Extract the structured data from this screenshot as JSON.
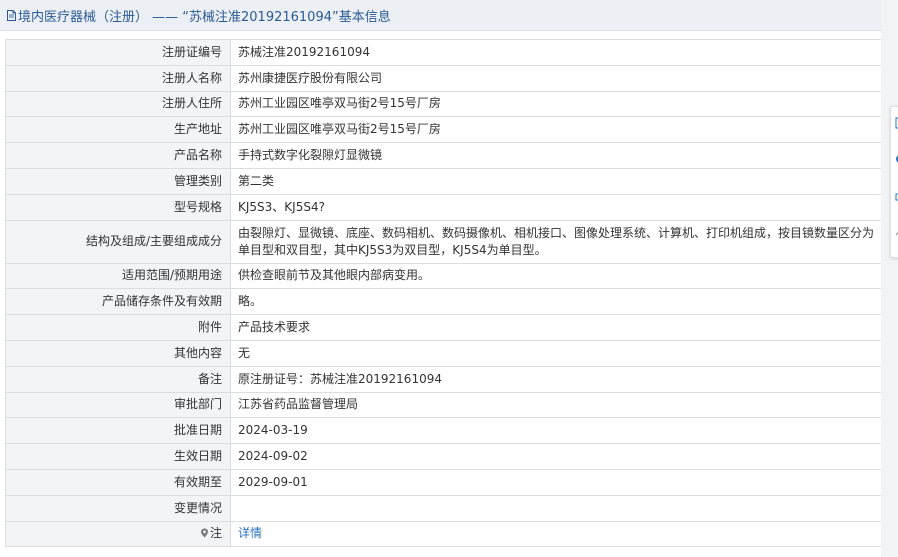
{
  "header": {
    "title": "境内医疗器械（注册） —— “苏械注准20192161094”基本信息"
  },
  "colors": {
    "header_bg": "#eceff3",
    "header_text": "#2a5b94",
    "label_bg": "#f3f4f6",
    "border": "#dddddd",
    "link": "#2a73c2"
  },
  "rows": [
    {
      "label": "注册证编号",
      "value": "苏械注准20192161094"
    },
    {
      "label": "注册人名称",
      "value": "苏州康捷医疗股份有限公司"
    },
    {
      "label": "注册人住所",
      "value": "苏州工业园区唯亭双马街2号15号厂房"
    },
    {
      "label": "生产地址",
      "value": "苏州工业园区唯亭双马街2号15号厂房"
    },
    {
      "label": "产品名称",
      "value": "手持式数字化裂隙灯显微镜"
    },
    {
      "label": "管理类别",
      "value": "第二类"
    },
    {
      "label": "型号规格",
      "value": "KJ5S3、KJ5S4?"
    },
    {
      "label": "结构及组成/主要组成成分",
      "value": "由裂隙灯、显微镜、底座、数码相机、数码摄像机、相机接口、图像处理系统、计算机、打印机组成，按目镜数量区分为单目型和双目型，其中KJ5S3为双目型，KJ5S4为单目型。"
    },
    {
      "label": "适用范围/预期用途",
      "value": "供检查眼前节及其他眼内部病变用。"
    },
    {
      "label": "产品储存条件及有效期",
      "value": "略。"
    },
    {
      "label": "附件",
      "value": "产品技术要求"
    },
    {
      "label": "其他内容",
      "value": "无"
    },
    {
      "label": "备注",
      "value": "原注册证号：苏械注准20192161094"
    },
    {
      "label": "审批部门",
      "value": "江苏省药品监督管理局"
    },
    {
      "label": "批准日期",
      "value": "2024-03-19"
    },
    {
      "label": "生效日期",
      "value": "2024-09-02"
    },
    {
      "label": "有效期至",
      "value": "2029-09-01"
    },
    {
      "label": "变更情况",
      "value": ""
    }
  ],
  "note": {
    "label": "注",
    "icon": "pin-icon",
    "link_text": "详情"
  }
}
